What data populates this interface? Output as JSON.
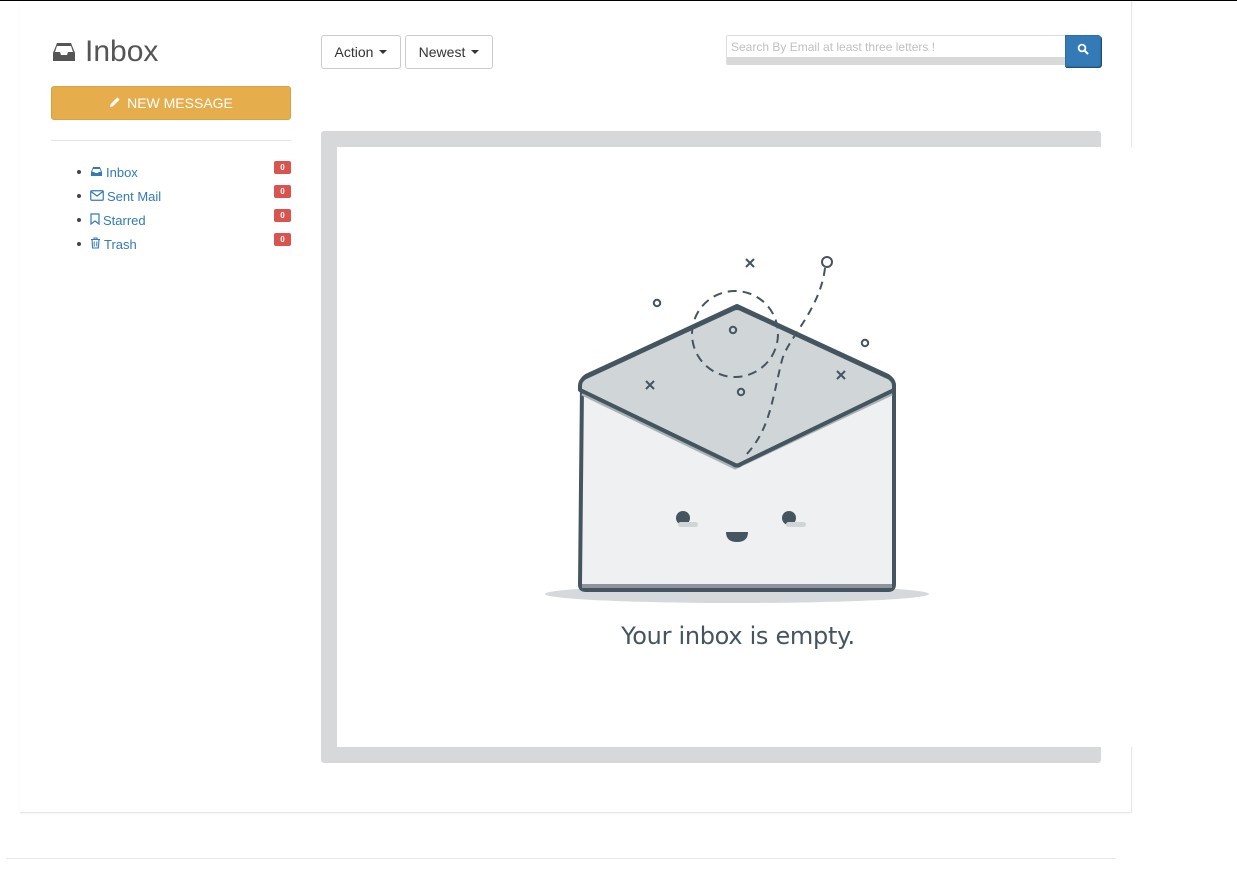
{
  "header": {
    "title": "Inbox"
  },
  "compose": {
    "label": "NEW MESSAGE"
  },
  "folders": [
    {
      "label": "Inbox",
      "count": "0",
      "icon": "inbox-icon"
    },
    {
      "label": "Sent Mail",
      "count": "0",
      "icon": "envelope-icon"
    },
    {
      "label": "Starred",
      "count": "0",
      "icon": "bookmark-icon"
    },
    {
      "label": "Trash",
      "count": "0",
      "icon": "trash-icon"
    }
  ],
  "toolbar": {
    "action_label": "Action",
    "sort_label": "Newest"
  },
  "search": {
    "placeholder": "Search By Email at least three letters !",
    "button_icon": "search-icon"
  },
  "empty_state": {
    "message": "Your inbox is empty."
  },
  "colors": {
    "compose": "#e6ad4c",
    "badge": "#d9534f",
    "link": "#337ab7",
    "search_button": "#337ab7",
    "empty_frame": "#d6d8da",
    "illustration": "#455560"
  }
}
